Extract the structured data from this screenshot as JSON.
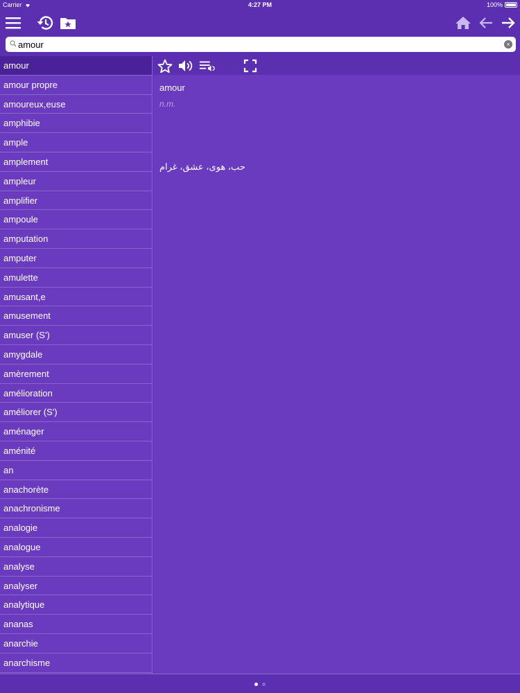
{
  "status_bar": {
    "carrier": "Carrier",
    "time": "4:27 PM",
    "battery": "100%"
  },
  "toolbar": {
    "icons": [
      "menu-icon",
      "history-icon",
      "favorites-folder-icon",
      "home-icon",
      "back-arrow-icon",
      "forward-arrow-icon"
    ]
  },
  "search": {
    "value": "amour",
    "placeholder": ""
  },
  "word_list": {
    "selected_index": 0,
    "items": [
      "amour",
      "amour propre",
      "amoureux,euse",
      "amphibie",
      "ample",
      "amplement",
      "ampleur",
      "amplifier",
      "ampoule",
      "amputation",
      "amputer",
      "amulette",
      "amusant,e",
      "amusement",
      "amuser (S')",
      "amygdale",
      "amèrement",
      "amélioration",
      "améliorer (S')",
      "aménager",
      "aménité",
      "an",
      "anachorète",
      "anachronisme",
      "analogie",
      "analogue",
      "analyse",
      "analyser",
      "analytique",
      "ananas",
      "anarchie",
      "anarchisme"
    ]
  },
  "detail": {
    "toolbar_icons": [
      "star-icon",
      "speaker-icon",
      "playlist-audio-icon",
      "fullscreen-icon"
    ],
    "word": "amour",
    "part_of_speech": "n.m.",
    "translation": "حب، هوى، عشق، غرام"
  },
  "pager": {
    "page": 1,
    "total": 2
  },
  "colors": {
    "primary": "#5b2fb0",
    "list_bg": "#6a3bbf",
    "selected": "#4a2198",
    "divider": "#8a67cf"
  }
}
